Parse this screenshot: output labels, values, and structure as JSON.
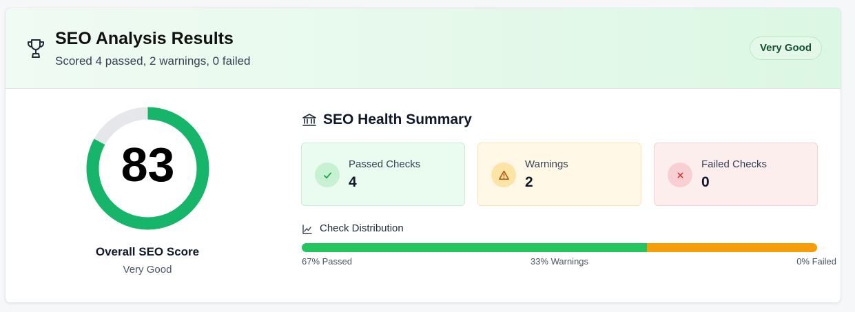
{
  "header": {
    "title": "SEO Analysis Results",
    "subtitle": "Scored 4 passed, 2 warnings, 0 failed",
    "badge": "Very Good",
    "icon": "trophy-icon"
  },
  "score": {
    "value": "83",
    "percent": 83,
    "label": "Overall SEO Score",
    "rating": "Very Good"
  },
  "summary": {
    "title": "SEO Health Summary",
    "icon": "bank-icon",
    "stats": [
      {
        "label": "Passed Checks",
        "value": "4",
        "icon": "check-icon"
      },
      {
        "label": "Warnings",
        "value": "2",
        "icon": "warning-icon"
      },
      {
        "label": "Failed Checks",
        "value": "0",
        "icon": "x-icon"
      }
    ]
  },
  "distribution": {
    "title": "Check Distribution",
    "icon": "chart-line-icon",
    "passed_label": "67% Passed",
    "warnings_label": "33% Warnings",
    "failed_label": "0% Failed",
    "passed_pct": 67,
    "warnings_pct": 33,
    "failed_pct": 0
  },
  "colors": {
    "pass": "#22c55e",
    "gauge": "#16b56a",
    "gauge_track": "#e5e7eb",
    "warn": "#f59e0b",
    "fail": "#ef4444"
  }
}
